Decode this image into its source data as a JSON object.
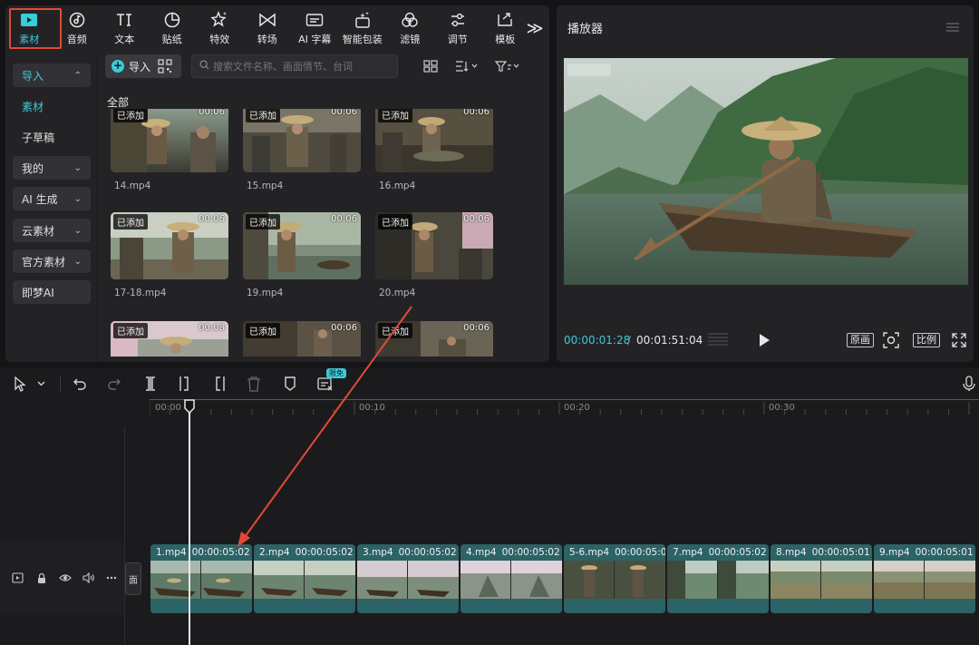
{
  "toolbar": {
    "items": [
      {
        "label": "素材",
        "icon": "media-icon"
      },
      {
        "label": "音频",
        "icon": "audio-icon"
      },
      {
        "label": "文本",
        "icon": "text-icon"
      },
      {
        "label": "贴纸",
        "icon": "sticker-icon"
      },
      {
        "label": "特效",
        "icon": "effects-icon"
      },
      {
        "label": "转场",
        "icon": "transition-icon"
      },
      {
        "label": "AI 字幕",
        "icon": "ai-caption-icon"
      },
      {
        "label": "智能包装",
        "icon": "smart-pack-icon"
      },
      {
        "label": "滤镜",
        "icon": "filter-icon"
      },
      {
        "label": "调节",
        "icon": "adjust-icon"
      },
      {
        "label": "模板",
        "icon": "template-icon"
      }
    ],
    "more_icon": "double-chevron-right-icon",
    "accent": "#3ccbd8",
    "highlight": "#e24a35"
  },
  "sidebar": {
    "items": [
      {
        "label": "导入",
        "chevron": "⌃"
      },
      {
        "label": "素材"
      },
      {
        "label": "子草稿"
      },
      {
        "label": "我的",
        "chevron": "⌄"
      },
      {
        "label": "AI 生成",
        "chevron": "⌄"
      },
      {
        "label": "云素材",
        "chevron": "⌄"
      },
      {
        "label": "官方素材",
        "chevron": "⌄"
      },
      {
        "label": "即梦AI"
      }
    ]
  },
  "media": {
    "import_label": "导入",
    "search_placeholder": "搜索文件名称、画面情节、台词",
    "section": "全部",
    "added_badge": "已添加",
    "items": [
      {
        "name": "14.mp4",
        "duration": "00:06"
      },
      {
        "name": "15.mp4",
        "duration": "00:06"
      },
      {
        "name": "16.mp4",
        "duration": "00:06"
      },
      {
        "name": "17-18.mp4",
        "duration": "00:06"
      },
      {
        "name": "19.mp4",
        "duration": "00:06"
      },
      {
        "name": "20.mp4",
        "duration": "00:06"
      },
      {
        "name": "",
        "duration": "00:08"
      },
      {
        "name": "",
        "duration": "00:06"
      },
      {
        "name": "",
        "duration": "00:06"
      }
    ]
  },
  "player": {
    "title": "播放器",
    "current_time": "00:00:01:28",
    "separator": "/",
    "total_time": "00:01:51:04",
    "original_label": "原画",
    "ratio_label": "比例"
  },
  "timeline": {
    "free_badge": "限免",
    "ruler_ticks": [
      "00:00",
      "00:10",
      "00:20",
      "00:30"
    ],
    "cover_label": "面",
    "clips": [
      {
        "name": "1.mp4",
        "duration": "00:00:05:02"
      },
      {
        "name": "2.mp4",
        "duration": "00:00:05:02"
      },
      {
        "name": "3.mp4",
        "duration": "00:00:05:02"
      },
      {
        "name": "4.mp4",
        "duration": "00:00:05:02"
      },
      {
        "name": "5-6.mp4",
        "duration": "00:00:05:0"
      },
      {
        "name": "7.mp4",
        "duration": "00:00:05:02"
      },
      {
        "name": "8.mp4",
        "duration": "00:00:05:01"
      },
      {
        "name": "9.mp4",
        "duration": "00:00:05:01"
      }
    ]
  }
}
